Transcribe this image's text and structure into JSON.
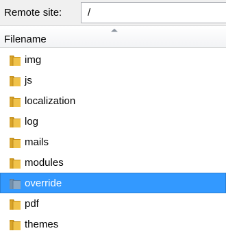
{
  "site_bar": {
    "label": "Remote site:",
    "path_value": "/"
  },
  "list_header": {
    "column_label": "Filename",
    "sort_direction": "ascending"
  },
  "files": [
    {
      "name": "img",
      "icon": "folder-icon",
      "selected": false
    },
    {
      "name": "js",
      "icon": "folder-icon",
      "selected": false
    },
    {
      "name": "localization",
      "icon": "folder-icon",
      "selected": false
    },
    {
      "name": "log",
      "icon": "folder-icon",
      "selected": false
    },
    {
      "name": "mails",
      "icon": "folder-icon",
      "selected": false
    },
    {
      "name": "modules",
      "icon": "folder-icon",
      "selected": false
    },
    {
      "name": "override",
      "icon": "folder-icon",
      "selected": true
    },
    {
      "name": "pdf",
      "icon": "folder-icon",
      "selected": false
    },
    {
      "name": "themes",
      "icon": "folder-icon",
      "selected": false
    }
  ],
  "colors": {
    "selection": "#3399ff",
    "folder": "#e8b53c",
    "folder_selected": "#7e9bb8"
  }
}
